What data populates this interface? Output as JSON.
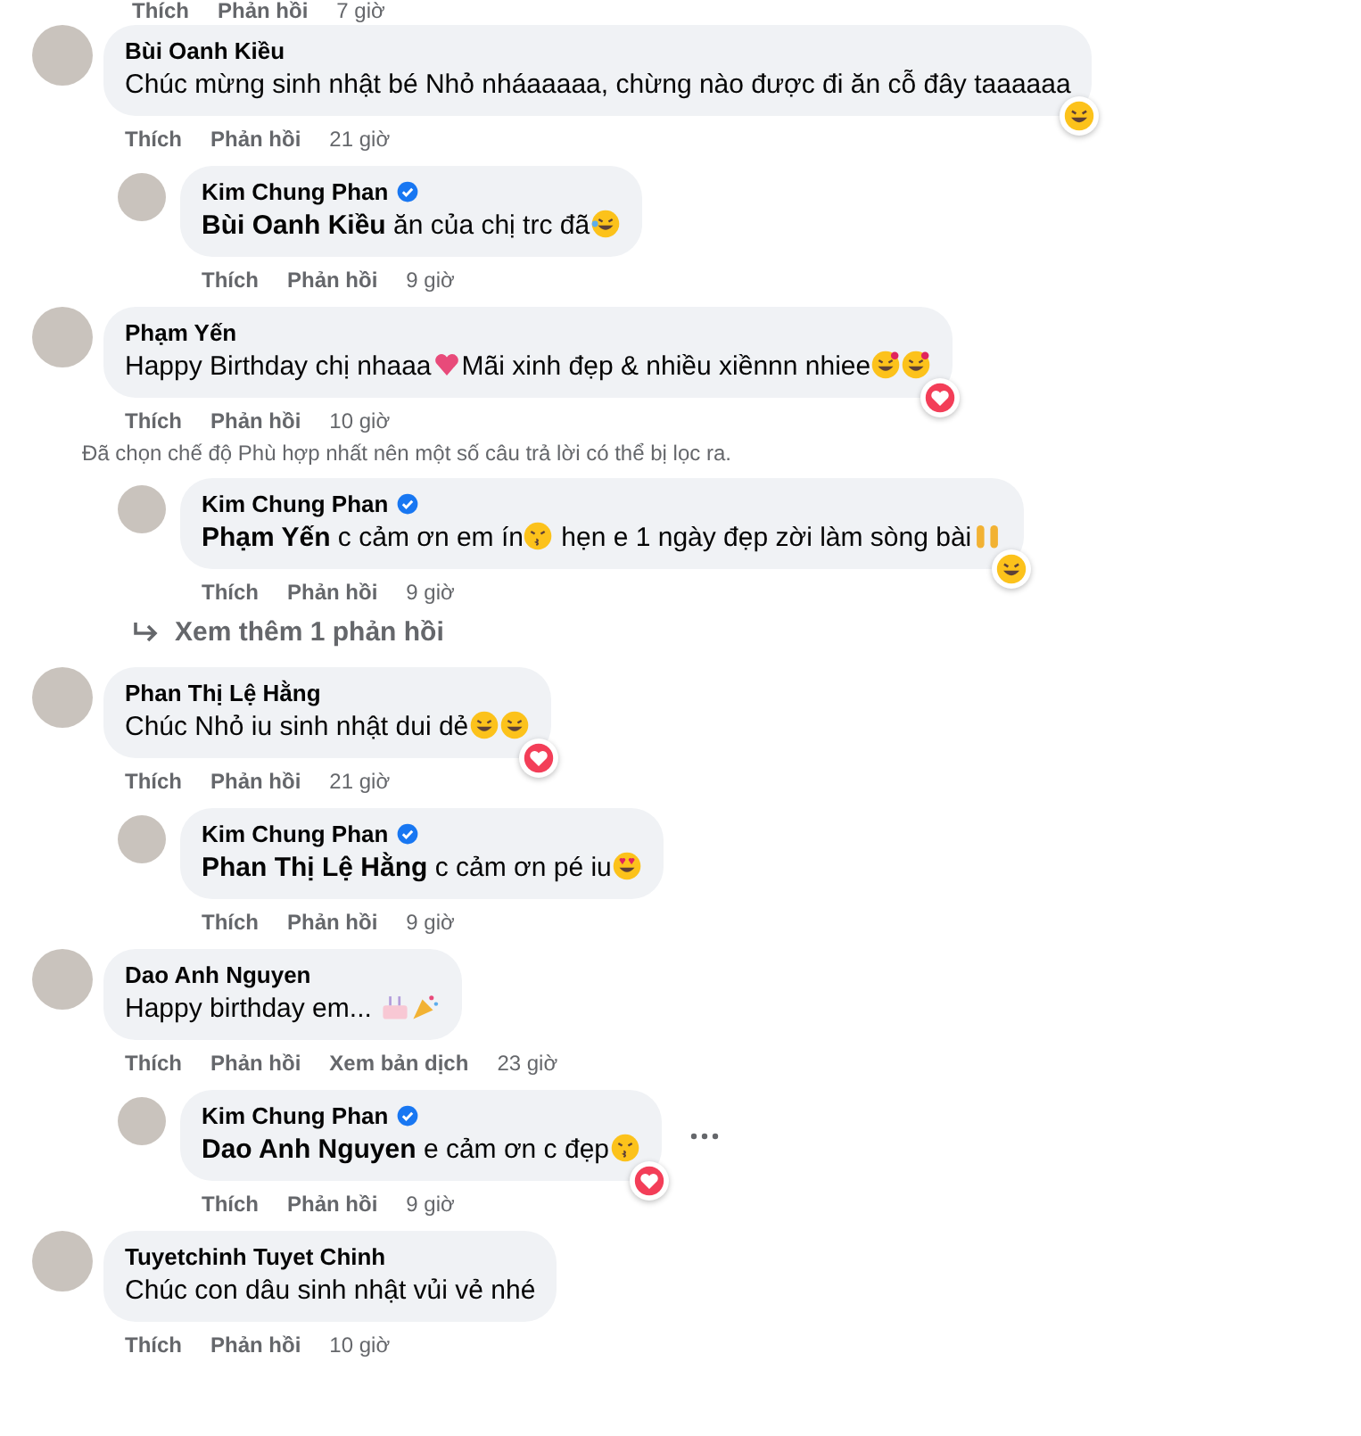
{
  "top_actions": {
    "actions": [
      "Thích",
      "Phản hồi"
    ],
    "time": "7 giờ"
  },
  "comments": [
    {
      "author": "Bùi Oanh Kiều",
      "verified": false,
      "message": [
        {
          "kind": "text",
          "text": "Chúc mừng sinh nhật bé Nhỏ nháaaaaa, chừng nào được đi ăn cỗ đây taaaaaa"
        }
      ],
      "reaction": {
        "kind": "haha"
      },
      "actions": [
        "Thích",
        "Phản hồi"
      ],
      "time": "21 giờ",
      "replies": [
        {
          "author": "Kim Chung Phan",
          "verified": true,
          "more_menu": false,
          "message": [
            {
              "kind": "mention",
              "text": "Bùi Oanh Kiều"
            },
            {
              "kind": "text",
              "text": " ăn của chị trc đã"
            },
            {
              "kind": "laughing"
            }
          ],
          "actions": [
            "Thích",
            "Phản hồi"
          ],
          "time": "9 giờ"
        }
      ]
    },
    {
      "author": "Phạm Yến",
      "verified": false,
      "message": [
        {
          "kind": "text",
          "text": "Happy Birthday chị nhaaa"
        },
        {
          "kind": "heart"
        },
        {
          "kind": "text",
          "text": "Mãi xinh đẹp & nhiều xiềnnn nhiee"
        },
        {
          "kind": "smiling"
        },
        {
          "kind": "smiling"
        }
      ],
      "reaction": {
        "kind": "love"
      },
      "actions": [
        "Thích",
        "Phản hồi"
      ],
      "time": "10 giờ",
      "note": "Đã chọn chế độ Phù hợp nhất nên một số câu trả lời có thể bị lọc ra.",
      "replies": [
        {
          "author": "Kim Chung Phan",
          "verified": true,
          "more_menu": false,
          "message": [
            {
              "kind": "mention",
              "text": "Phạm Yến"
            },
            {
              "kind": "text",
              "text": " c cảm ơn em ín"
            },
            {
              "kind": "kissing"
            },
            {
              "kind": "text",
              "text": " hẹn e 1 ngày đẹp zời làm sòng bài"
            },
            {
              "kind": "hands"
            }
          ],
          "reaction": {
            "kind": "haha"
          },
          "actions": [
            "Thích",
            "Phản hồi"
          ],
          "time": "9 giờ"
        }
      ],
      "more_replies": "Xem thêm 1 phản hồi"
    },
    {
      "author": "Phan Thị Lệ Hằng",
      "verified": false,
      "message": [
        {
          "kind": "text",
          "text": "Chúc Nhỏ iu sinh nhật dui dẻ"
        },
        {
          "kind": "tired"
        },
        {
          "kind": "tired"
        }
      ],
      "reaction": {
        "kind": "love"
      },
      "actions": [
        "Thích",
        "Phản hồi"
      ],
      "time": "21 giờ",
      "replies": [
        {
          "author": "Kim Chung Phan",
          "verified": true,
          "more_menu": false,
          "message": [
            {
              "kind": "mention",
              "text": "Phan Thị Lệ Hằng"
            },
            {
              "kind": "text",
              "text": " c cảm ơn pé iu"
            },
            {
              "kind": "hearteyes"
            }
          ],
          "actions": [
            "Thích",
            "Phản hồi"
          ],
          "time": "9 giờ"
        }
      ]
    },
    {
      "author": "Dao Anh Nguyen",
      "verified": false,
      "message": [
        {
          "kind": "text",
          "text": "Happy birthday em... "
        },
        {
          "kind": "cake"
        },
        {
          "kind": "party"
        }
      ],
      "actions": [
        "Thích",
        "Phản hồi",
        "Xem bản dịch"
      ],
      "time": "23 giờ",
      "replies": [
        {
          "author": "Kim Chung Phan",
          "verified": true,
          "more_menu": true,
          "message": [
            {
              "kind": "mention",
              "text": "Dao Anh Nguyen"
            },
            {
              "kind": "text",
              "text": " e cảm ơn c đẹp"
            },
            {
              "kind": "kissing"
            }
          ],
          "reaction": {
            "kind": "love"
          },
          "actions": [
            "Thích",
            "Phản hồi"
          ],
          "time": "9 giờ"
        }
      ]
    },
    {
      "author": "Tuyetchinh Tuyet Chinh",
      "verified": false,
      "message": [
        {
          "kind": "text",
          "text": "Chúc con dâu sinh nhật vủi vẻ nhé"
        }
      ],
      "actions": [
        "Thích",
        "Phản hồi"
      ],
      "time": "10 giờ"
    }
  ]
}
